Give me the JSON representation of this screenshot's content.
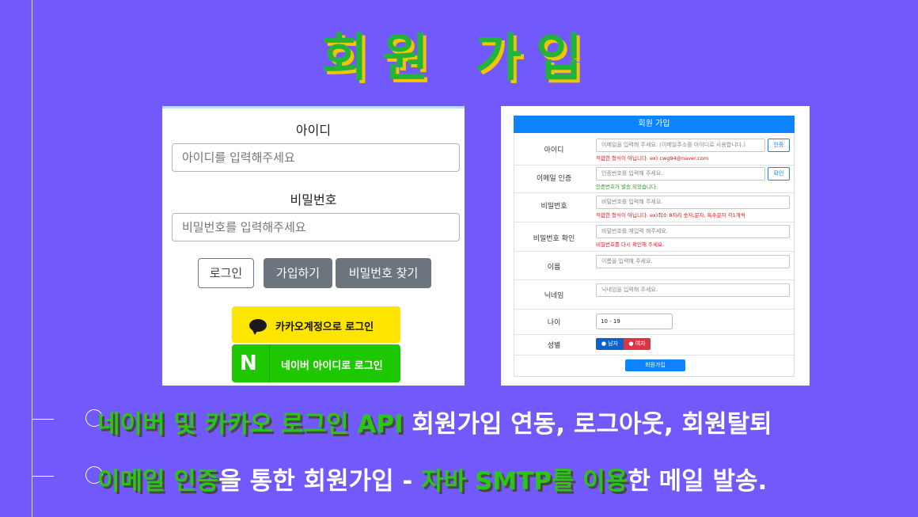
{
  "title": "회원 가입",
  "login": {
    "id_label": "아이디",
    "id_placeholder": "아이디를 입력해주세요",
    "pw_label": "비밀번호",
    "pw_placeholder": "비밀번호를 입력해주세요",
    "login_button": "로그인",
    "signup_button": "가입하기",
    "find_pw_button": "비밀번호 찾기",
    "kakao_button": "카카오계정으로 로그인",
    "naver_logo": "N",
    "naver_button": "네이버 아이디로 로그인"
  },
  "signup_form": {
    "header": "회원 가입",
    "rows": {
      "id": {
        "label": "아이디",
        "placeholder": "이메일을 입력해 주세요. (이메일주소를 아이디로 사용합니다.)",
        "button": "인증",
        "message": "적합한 형식이 아닙니다. ex) cwg94@naver.com"
      },
      "email_verify": {
        "label": "이메일 인증",
        "placeholder": "인증번호를 입력해 주세요.",
        "button": "확인",
        "message": "인증번호가 발송 되었습니다."
      },
      "password": {
        "label": "비밀번호",
        "placeholder": "비밀번호를 입력해 주세요.",
        "message": "적합한 형식이 아닙니다. ex)최소 8자리 숫자,문자, 특수문자 각1개씩"
      },
      "password_confirm": {
        "label": "비밀번호 확인",
        "placeholder": "비밀번호를 재입력 해주세요.",
        "message": "비밀번호를 다시 확인해 주세요."
      },
      "name": {
        "label": "이름",
        "placeholder": "이름을 입력해 주세요."
      },
      "nickname": {
        "label": "닉네임",
        "placeholder": "닉네임을 입력해 주세요."
      },
      "age": {
        "label": "나이",
        "value": "10 - 19"
      },
      "gender": {
        "label": "성별",
        "male": "남자",
        "female": "여자"
      }
    },
    "submit": "회원가입"
  },
  "bullets": [
    {
      "highlight": "네이버 및 카카오 로그인 API",
      "rest": " 회원가입 연동, 로그아웃, 회원탈퇴"
    },
    {
      "hl1": "이메일 인증",
      "mid": "을 통한 회원가입 - ",
      "hl2": "자바 SMTP를 이용",
      "end": "한 메일 발송."
    }
  ],
  "colors": {
    "background": "#7259fb",
    "title_green": "#22b33a",
    "title_shadow": "#f5c400",
    "kakao_yellow": "#fee500",
    "naver_green": "#1ec800",
    "form_blue": "#0d84ff",
    "error_red": "#e01010",
    "success_green": "#18a018"
  }
}
